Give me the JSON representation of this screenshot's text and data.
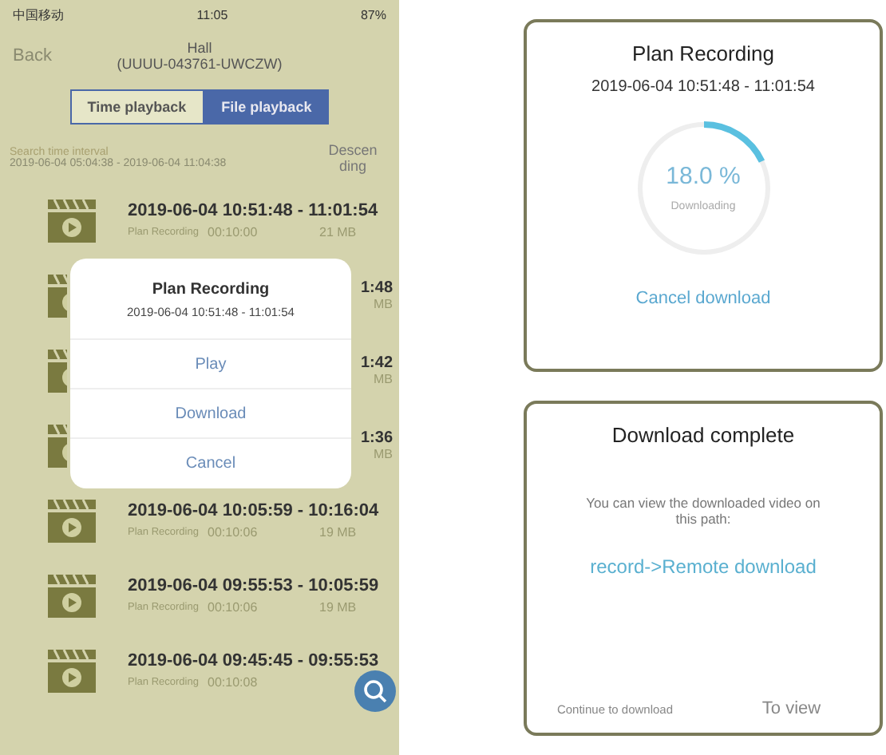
{
  "phone": {
    "status_bar": {
      "carrier": "中国移动",
      "time": "11:05",
      "battery": "87%"
    },
    "nav": {
      "back": "Back",
      "title": "Hall",
      "subtitle": "(UUUU-043761-UWCZW)"
    },
    "tabs": [
      {
        "label": "Time playback",
        "selected": false
      },
      {
        "label": "File playback",
        "selected": true
      }
    ],
    "search": {
      "label": "Search time interval",
      "range": "2019-06-04 05:04:38 - 2019-06-04 11:04:38",
      "sort": "Descending"
    },
    "recordings": [
      {
        "kind": "full",
        "time": "2019-06-04  10:51:48 - 11:01:54",
        "type": "Plan Recording",
        "duration": "00:10:00",
        "size": "21 MB"
      },
      {
        "kind": "covered",
        "time": "1:48",
        "size": "MB"
      },
      {
        "kind": "covered",
        "time": "1:42",
        "size": "MB"
      },
      {
        "kind": "covered",
        "time": "1:36",
        "size": "MB"
      },
      {
        "kind": "full",
        "time": "2019-06-04  10:05:59 - 10:16:04",
        "type": "Plan Recording",
        "duration": "00:10:06",
        "size": "19 MB"
      },
      {
        "kind": "full",
        "time": "2019-06-04  09:55:53 - 10:05:59",
        "type": "Plan Recording",
        "duration": "00:10:06",
        "size": "19 MB"
      },
      {
        "kind": "full",
        "time": "2019-06-04  09:45:45 - 09:55:53",
        "type": "Plan Recording",
        "duration": "00:10:08"
      }
    ],
    "dialog": {
      "title": "Plan Recording",
      "time": "2019-06-04  10:51:48 - 11:01:54",
      "actions": [
        "Play",
        "Download",
        "Cancel"
      ]
    }
  },
  "progress_dialog": {
    "title": "Plan Recording",
    "time": "2019-06-04  10:51:48 - 11:01:54",
    "percent": "18.0 %",
    "level": 0.18,
    "status": "Downloading",
    "action": "Cancel download"
  },
  "complete_dialog": {
    "title": "Download complete",
    "message": "You can view the downloaded video on this path:",
    "path": "record->Remote download",
    "buttons": [
      "Continue to download",
      "To view"
    ]
  }
}
